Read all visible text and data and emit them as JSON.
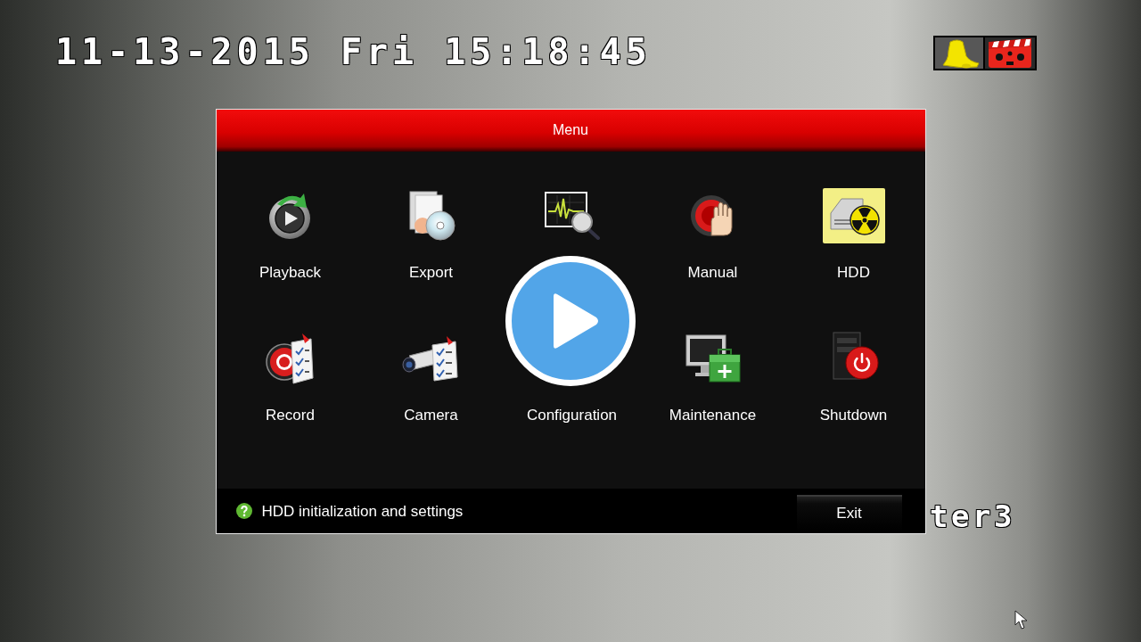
{
  "osd": {
    "timestamp": "11-13-2015 Fri 15:18:45",
    "channel_label": "ter3"
  },
  "menu": {
    "title": "Menu",
    "items": [
      {
        "label": "Playback",
        "selected": false
      },
      {
        "label": "Export",
        "selected": false
      },
      {
        "selected": false
      },
      {
        "label": "Manual",
        "selected": false
      },
      {
        "label": "HDD",
        "selected": true
      },
      {
        "label": "Record",
        "selected": false
      },
      {
        "label": "Camera",
        "selected": false
      },
      {
        "label": "Configuration",
        "selected": false
      },
      {
        "label": "Maintenance",
        "selected": false
      },
      {
        "label": "Shutdown",
        "selected": false
      }
    ],
    "hint": "HDD initialization and settings",
    "buttons": [
      "Exit"
    ]
  }
}
